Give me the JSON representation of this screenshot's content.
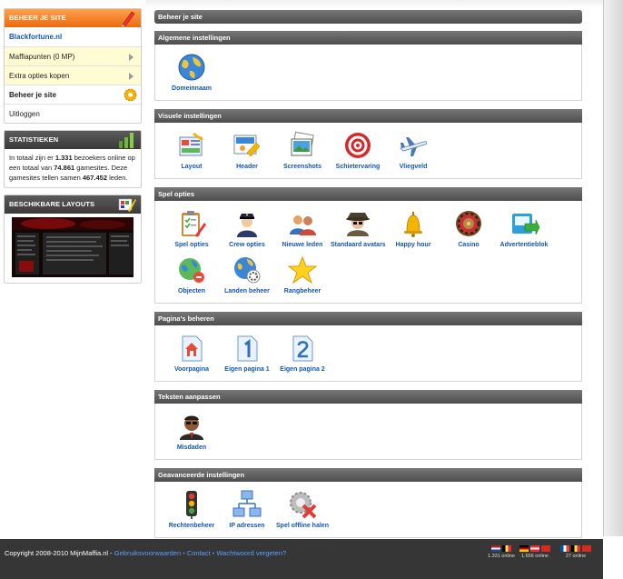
{
  "sidebar": {
    "manage_header": "BEHEER JE SITE",
    "menu": [
      {
        "label": "Blackfortune.nl"
      },
      {
        "label": "Maffiapunten (0 MP)"
      },
      {
        "label": "Extra opties kopen"
      },
      {
        "label": "Beheer je site"
      },
      {
        "label": "Uitloggen"
      }
    ],
    "stats_header": "STATISTIEKEN",
    "stats": {
      "t1": "In totaal zijn er ",
      "visitors": "1.331",
      "t2": " bezoekers online op een totaal van ",
      "gamesites": "74.861",
      "t3": " gamesites. Deze gamesites tellen samen ",
      "members": "467.452",
      "t4": " leden."
    },
    "layouts_header": "BESCHIKBARE LAYOUTS"
  },
  "main": {
    "title": "Beheer je site",
    "sections": [
      {
        "title": "Algemene instellingen",
        "items": [
          {
            "label": "Domeinnaam",
            "icon": "globe-icon"
          }
        ]
      },
      {
        "title": "Visuele instellingen",
        "items": [
          {
            "label": "Layout",
            "icon": "layout-icon"
          },
          {
            "label": "Header",
            "icon": "header-icon"
          },
          {
            "label": "Screenshots",
            "icon": "screenshots-icon"
          },
          {
            "label": "Schietervaring",
            "icon": "target-icon"
          },
          {
            "label": "Vliegveld",
            "icon": "airplane-icon"
          }
        ]
      },
      {
        "title": "Spel opties",
        "items": [
          {
            "label": "Spel opties",
            "icon": "clipboard-icon"
          },
          {
            "label": "Crew opties",
            "icon": "police-icon"
          },
          {
            "label": "Nieuwe leden",
            "icon": "users-icon"
          },
          {
            "label": "Standaard avatars",
            "icon": "avatar-icon"
          },
          {
            "label": "Happy hour",
            "icon": "bell-icon"
          },
          {
            "label": "Casino",
            "icon": "roulette-icon"
          },
          {
            "label": "Advertentieblok",
            "icon": "ad-icon"
          },
          {
            "label": "Objecten",
            "icon": "objects-icon"
          },
          {
            "label": "Landen beheer",
            "icon": "countries-icon"
          },
          {
            "label": "Rangbeheer",
            "icon": "star-icon"
          }
        ]
      },
      {
        "title": "Pagina's beheren",
        "items": [
          {
            "label": "Voorpagina",
            "icon": "home-page-icon"
          },
          {
            "label": "Eigen pagina 1",
            "icon": "page-one-icon"
          },
          {
            "label": "Eigen pagina 2",
            "icon": "page-two-icon"
          }
        ]
      },
      {
        "title": "Teksten aanpassen",
        "items": [
          {
            "label": "Misdaden",
            "icon": "mobster-icon"
          }
        ]
      },
      {
        "title": "Geavanceerde instellingen",
        "items": [
          {
            "label": "Rechtenbeheer",
            "icon": "traffic-light-icon"
          },
          {
            "label": "IP adressen",
            "icon": "network-icon"
          },
          {
            "label": "Spel offline halen",
            "icon": "offline-icon"
          }
        ]
      }
    ]
  },
  "footer": {
    "copyright": "Copyright 2008-2010 MijnMaffia.nl - ",
    "link_terms": "Gebruiksvoorwaarden",
    "sep1": " - ",
    "link_contact": "Contact",
    "sep2": " - ",
    "link_password": "Wachtwoord vergeten?",
    "flag_groups": [
      {
        "online": "1.331 online"
      },
      {
        "online": "1.656 online"
      },
      {
        "online": "27 online"
      }
    ]
  }
}
